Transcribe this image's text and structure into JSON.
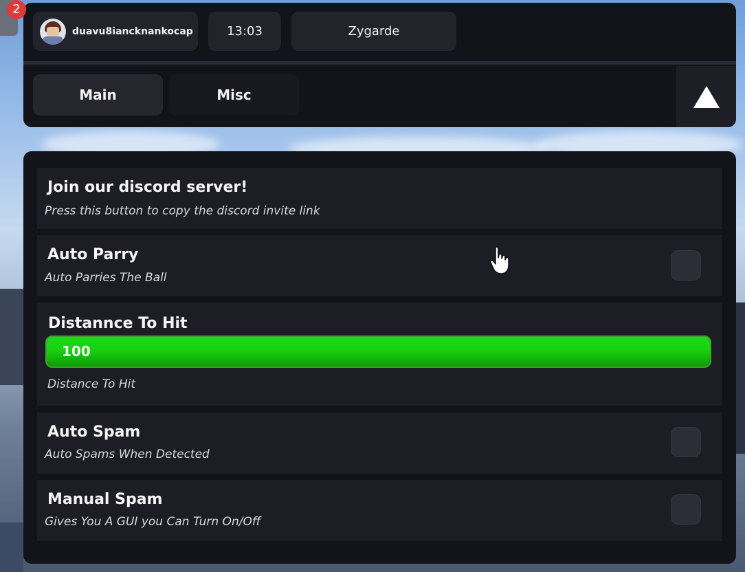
{
  "notification": {
    "count": "2"
  },
  "header": {
    "username": "duavu8iancknankocap",
    "time": "13:03",
    "title": "Zygarde",
    "tabs": [
      {
        "label": "Main",
        "active": true
      },
      {
        "label": "Misc",
        "active": false
      }
    ],
    "collapse_icon": "triangle-up-icon"
  },
  "panel": {
    "discord": {
      "title": "Join our discord server!",
      "description": "Press this button to copy the discord invite link"
    },
    "auto_parry": {
      "title": "Auto Parry",
      "description": "Auto Parries The Ball",
      "enabled": false
    },
    "distance": {
      "title": "Distannce To Hit",
      "value": "100",
      "fill_fraction": 1.0,
      "description": "Distance To Hit"
    },
    "auto_spam": {
      "title": "Auto Spam",
      "description": "Auto Spams When Detected",
      "enabled": false
    },
    "manual_spam": {
      "title": "Manual Spam",
      "description": "Gives You A GUI you Can Turn On/Off",
      "enabled": false
    }
  },
  "colors": {
    "panel_bg": "#131419",
    "card_bg": "#1d1e25",
    "slider_fill": "#19d10f",
    "badge": "#e03a3a"
  }
}
